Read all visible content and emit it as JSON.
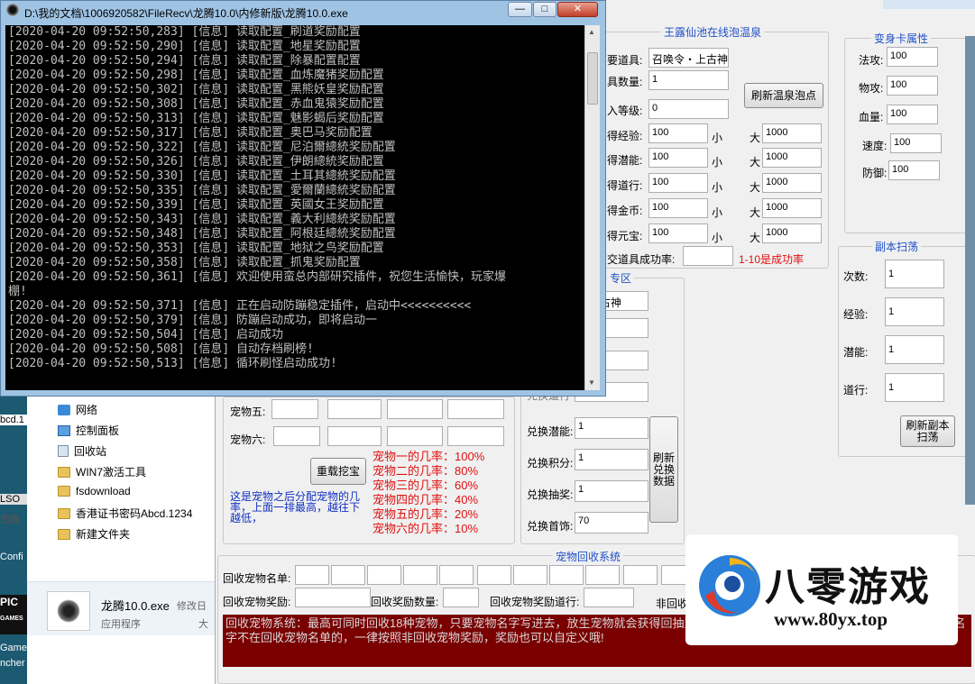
{
  "console": {
    "title": "D:\\我的文档\\1006920582\\FileRecv\\龙腾10.0\\内修新版\\龙腾10.0.exe",
    "lines": [
      "[2020-04-20 09:52:50,283] [信息] 读取配置_刷道奖励配置",
      "[2020-04-20 09:52:50,290] [信息] 读取配置_地星奖励配置",
      "[2020-04-20 09:52:50,294] [信息] 读取配置_除暴配置配置",
      "[2020-04-20 09:52:50,298] [信息] 读取配置_血炼魔猪奖励配置",
      "[2020-04-20 09:52:50,302] [信息] 读取配置_黑熊妖皇奖励配置",
      "[2020-04-20 09:52:50,308] [信息] 读取配置_赤血鬼猿奖励配置",
      "[2020-04-20 09:52:50,313] [信息] 读取配置_魅影蝎后奖励配置",
      "[2020-04-20 09:52:50,317] [信息] 读取配置_奥巴马奖励配置",
      "[2020-04-20 09:52:50,322] [信息] 读取配置_尼泊爾總統奖励配置",
      "[2020-04-20 09:52:50,326] [信息] 读取配置_伊朗總統奖励配置",
      "[2020-04-20 09:52:50,330] [信息] 读取配置_土耳其總統奖励配置",
      "[2020-04-20 09:52:50,335] [信息] 读取配置_愛爾蘭總統奖励配置",
      "[2020-04-20 09:52:50,339] [信息] 读取配置_英國女王奖励配置",
      "[2020-04-20 09:52:50,343] [信息] 读取配置_義大利總統奖励配置",
      "[2020-04-20 09:52:50,348] [信息] 读取配置_阿根廷總統奖励配置",
      "[2020-04-20 09:52:50,353] [信息] 读取配置_地狱之鸟奖励配置",
      "[2020-04-20 09:52:50,358] [信息] 读取配置_抓鬼奖励配置",
      "[2020-04-20 09:52:50,361] [信息] 欢迎使用蛮总内部研究插件，祝您生活愉快，玩家爆",
      "棚!",
      "[2020-04-20 09:52:50,371] [信息] 正在启动防蹦稳定插件，启动中<<<<<<<<<<",
      "[2020-04-20 09:52:50,379] [信息] 防蹦启动成功，即将启动一",
      "[2020-04-20 09:52:50,504] [信息] 启动成功",
      "[2020-04-20 09:52:50,508] [信息] 自动存档刷榜!",
      "[2020-04-20 09:52:50,513] [信息] 循环刷怪启动成功!"
    ]
  },
  "hotspring": {
    "title": "王露仙池在线泡温泉",
    "item_label": "要道具:",
    "item_value": "召唤令・上古神",
    "qty_label": "具数量:",
    "qty_value": "1",
    "level_label": "入等级:",
    "level_value": "0",
    "refresh_btn": "刷新温泉泡点",
    "rows": [
      {
        "label": "得经验:",
        "min": "100",
        "max": "1000"
      },
      {
        "label": "得潜能:",
        "min": "100",
        "max": "1000"
      },
      {
        "label": "得道行:",
        "min": "100",
        "max": "1000"
      },
      {
        "label": "得金币:",
        "min": "100",
        "max": "1000"
      },
      {
        "label": "得元宝:",
        "min": "100",
        "max": "1000"
      }
    ],
    "small": "小",
    "big": "大",
    "rate_label": "交道具成功率:",
    "rate_value": "",
    "rate_hint": "1-10是成功率"
  },
  "transform": {
    "title": "变身卡属性",
    "fields": [
      {
        "label": "法攻:",
        "value": "100"
      },
      {
        "label": "物攻:",
        "value": "100"
      },
      {
        "label": "血量:",
        "value": "100"
      },
      {
        "label": "速度:",
        "value": "100"
      },
      {
        "label": "防御:",
        "value": "100"
      }
    ]
  },
  "dungeon": {
    "title": "副本扫荡",
    "fields": [
      {
        "label": "次数:",
        "value": "1"
      },
      {
        "label": "经验:",
        "value": "1"
      },
      {
        "label": "潜能:",
        "value": "1"
      },
      {
        "label": "道行:",
        "value": "1"
      }
    ],
    "refresh_btn": "刷新副本扫荡"
  },
  "exchange": {
    "title": "专区",
    "item_value": "・上古神",
    "fields": [
      {
        "label": "兑换潜能:",
        "value": "1"
      },
      {
        "label": "兑换积分:",
        "value": "1"
      },
      {
        "label": "兑换抽奖:",
        "value": "1"
      },
      {
        "label": "兑换首饰:",
        "value": "70"
      }
    ],
    "refresh_btn": "刷新兑换数据",
    "partial_label": "兑换道行"
  },
  "pets": {
    "pet5_label": "宠物五:",
    "pet6_label": "宠物六:",
    "reload_btn": "重载挖宝",
    "note": "这是宠物之后分配宠物的几率，上面一排最高，越往下越低，",
    "rates": [
      "宠物一的几率：100%",
      "宠物二的几率：80%",
      "宠物三的几率：60%",
      "宠物四的几率：40%",
      "宠物五的几率：20%",
      "宠物六的几率：10%"
    ]
  },
  "recycle": {
    "title": "宠物回收系统",
    "names_label": "回收宠物名单:",
    "reward_label": "回收宠物奖励:",
    "count_label": "回收奖励数量:",
    "tao_label": "回收宠物奖励道行:",
    "non_label": "非回收",
    "info": "回收宠物系统：最高可同时回收18种宠物，只要宠物名字写进去，放生宠物就会获得回抽宠物编辑框填写的道具，回收奖励数量自定义。如果名字不在回收宠物名单的，一律按照非回收宠物奖励，奖励也可以自定义哦!"
  },
  "explorer": {
    "items": [
      "网络",
      "控制面板",
      "回收站",
      "WIN7激活工具",
      "fsdownload",
      "香港证书密码Abcd.1234",
      "新建文件夹"
    ],
    "file_name": "龙腾10.0.exe",
    "file_type": "应用程序",
    "file_meta": "修改日",
    "file_meta2": "大"
  },
  "desktop": {
    "left_texts": [
      "bcd.1",
      "LSO",
      "图像",
      "Confi",
      "PIC",
      "GAMES",
      "Games",
      "ncher"
    ]
  },
  "watermark": {
    "name": "八零游戏",
    "url": "www.80yx.top"
  },
  "colors": {
    "accent": "#1e50c8",
    "red": "#e01010",
    "info_bg": "#7a0000"
  }
}
